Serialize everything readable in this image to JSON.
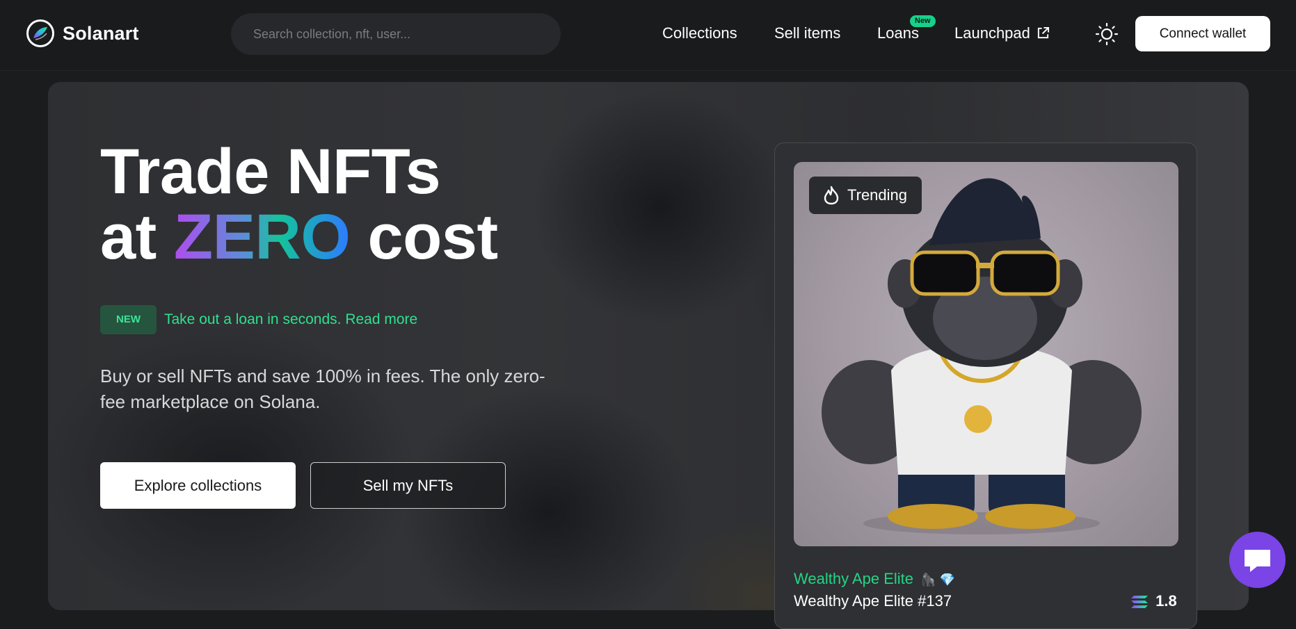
{
  "header": {
    "brand": "Solanart",
    "search_placeholder": "Search collection, nft, user...",
    "nav": [
      {
        "label": "Collections"
      },
      {
        "label": "Sell items"
      },
      {
        "label": "Loans",
        "badge": "New"
      },
      {
        "label": "Launchpad",
        "icon": "external-link-icon"
      }
    ],
    "theme_icon": "sun-icon",
    "connect_label": "Connect wallet"
  },
  "hero": {
    "headline_line1": "Trade NFTs",
    "headline_at": "at",
    "headline_zero": "ZERO",
    "headline_cost": "cost",
    "new_pill": "NEW",
    "loan_text": "Take out a loan in seconds. Read more",
    "description": "Buy or sell NFTs and save 100% in fees. The only zero-fee marketplace on Solana.",
    "explore_label": "Explore collections",
    "sell_label": "Sell my NFTs"
  },
  "trending": {
    "badge": "Trending",
    "badge_icon": "flame-icon",
    "collection": "Wealthy Ape Elite",
    "collection_emoji": "🦍 💎",
    "item": "Wealthy Ape Elite #137",
    "price": "1.8",
    "price_icon": "solana-icon"
  },
  "chat": {
    "icon": "chat-icon"
  },
  "colors": {
    "accent_green": "#22d685",
    "chat_purple": "#7a44e6",
    "badge_green": "#17d18a"
  }
}
